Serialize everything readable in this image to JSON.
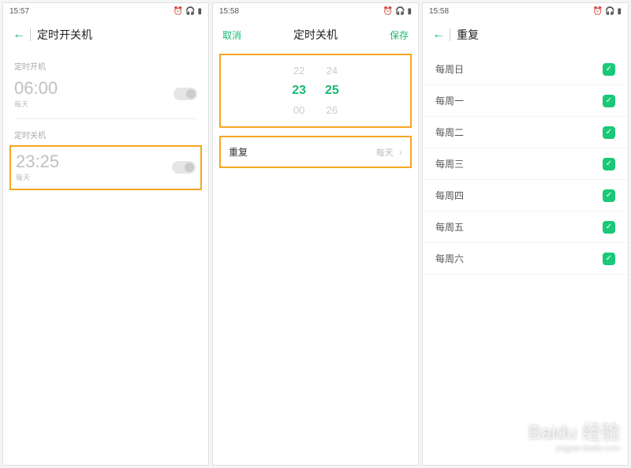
{
  "status": {
    "time1": "15:57",
    "time2": "15:58",
    "time3": "15:58"
  },
  "screen1": {
    "title": "定时开关机",
    "section_on_label": "定时开机",
    "on_time": "06:00",
    "on_sub": "每天",
    "section_off_label": "定时关机",
    "off_time": "23:25",
    "off_sub": "每天"
  },
  "screen2": {
    "cancel": "取消",
    "title": "定时关机",
    "save": "保存",
    "picker": {
      "h_prev": "22",
      "h_sel": "23",
      "h_next": "00",
      "m_prev": "24",
      "m_sel": "25",
      "m_next": "26"
    },
    "repeat_label": "重复",
    "repeat_value": "每天"
  },
  "screen3": {
    "title": "重复",
    "days": [
      "每周日",
      "每周一",
      "每周二",
      "每周三",
      "每周四",
      "每周五",
      "每周六"
    ]
  },
  "watermark": {
    "main": "Baidu 经验",
    "sub": "jingyan.baidu.com"
  }
}
